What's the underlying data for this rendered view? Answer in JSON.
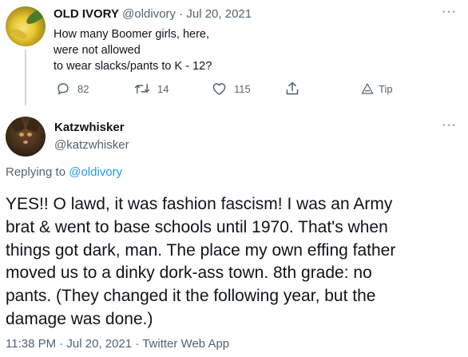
{
  "parent_tweet": {
    "display_name": "OLD IVORY",
    "meta": "@oldivory · Jul 20, 2021",
    "text_lines": [
      "How many Boomer girls, here,",
      "were not allowed",
      "to wear slacks/pants to K - 12?"
    ],
    "more_label": "···",
    "actions": {
      "reply_count": "82",
      "retweet_count": "14",
      "like_count": "115",
      "tip_label": "Tip"
    }
  },
  "reply_tweet": {
    "display_name": "Katzwhisker",
    "handle": "@katzwhisker",
    "more_label": "···",
    "replying_prefix": "Replying to ",
    "replying_to": "@oldivory",
    "text_lines": [
      "YES!!  O lawd, it was fashion fascism!  I was an Army",
      "brat & went to base schools until 1970.  That's when",
      "things got dark, man.  The place my own effing father",
      "moved us to a dinky dork-ass town. 8th grade: no",
      "pants. (They changed it the following year, but the",
      "damage was done.)"
    ],
    "footer": "11:38 PM · Jul 20, 2021 · Twitter Web App"
  },
  "icons": {
    "reply": "comment-icon",
    "retweet": "retweet-icon",
    "like": "heart-icon",
    "share": "share-icon",
    "tip": "tip-icon",
    "more": "more-icon"
  },
  "colors": {
    "text_primary": "#0f1419",
    "text_secondary": "#536471",
    "link": "#1d9bf0",
    "thread_line": "#cfd9de"
  }
}
